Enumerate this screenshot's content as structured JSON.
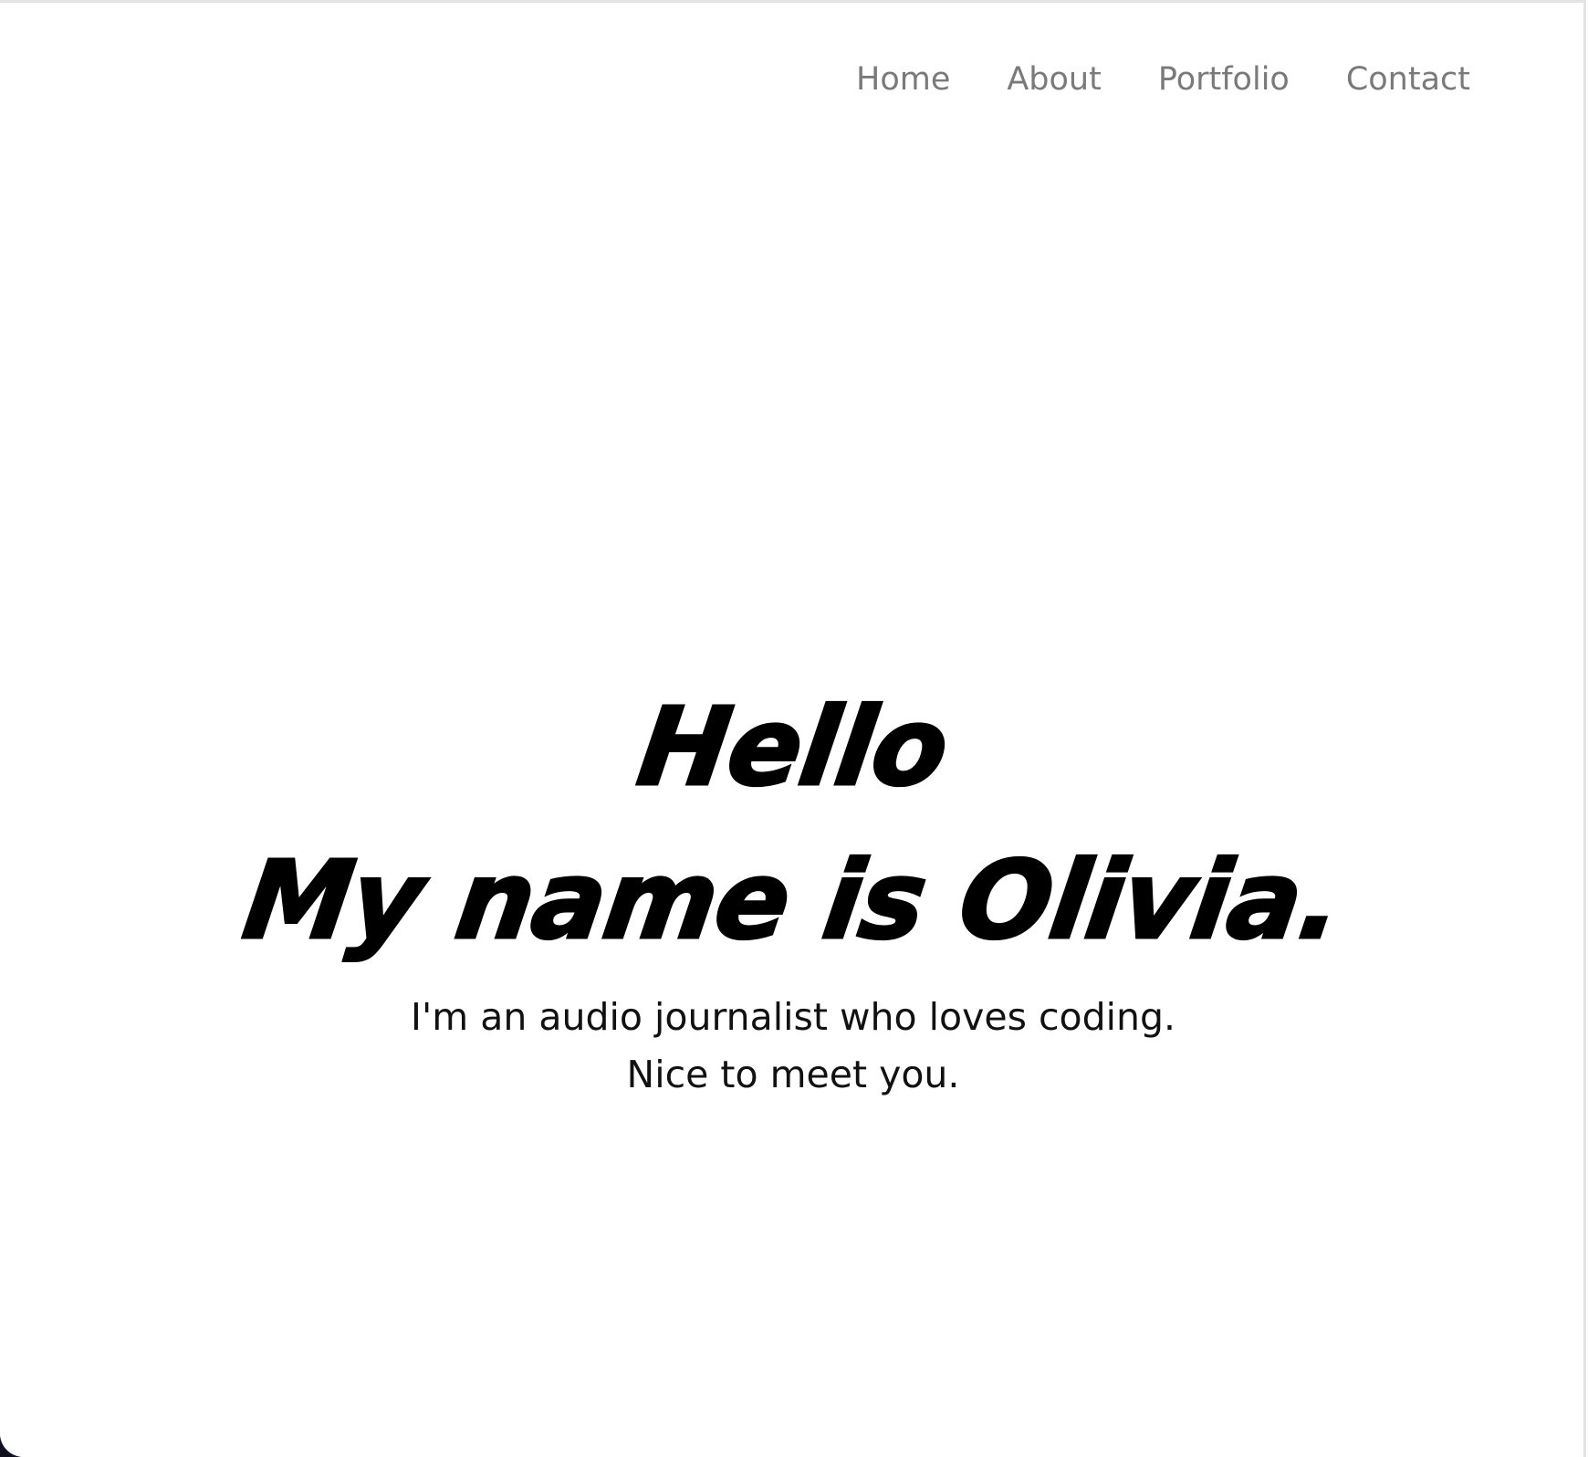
{
  "nav": {
    "items": [
      {
        "label": "Home"
      },
      {
        "label": "About"
      },
      {
        "label": "Portfolio"
      },
      {
        "label": "Contact"
      }
    ]
  },
  "hero": {
    "greeting": "Hello",
    "name_line": "My name is Olivia.",
    "tagline": "I'm an audio journalist who loves coding.",
    "closing": "Nice to meet you."
  },
  "colors": {
    "background": "#ffffff",
    "nav_text": "#7a7a7a",
    "heading_text": "#000000"
  }
}
